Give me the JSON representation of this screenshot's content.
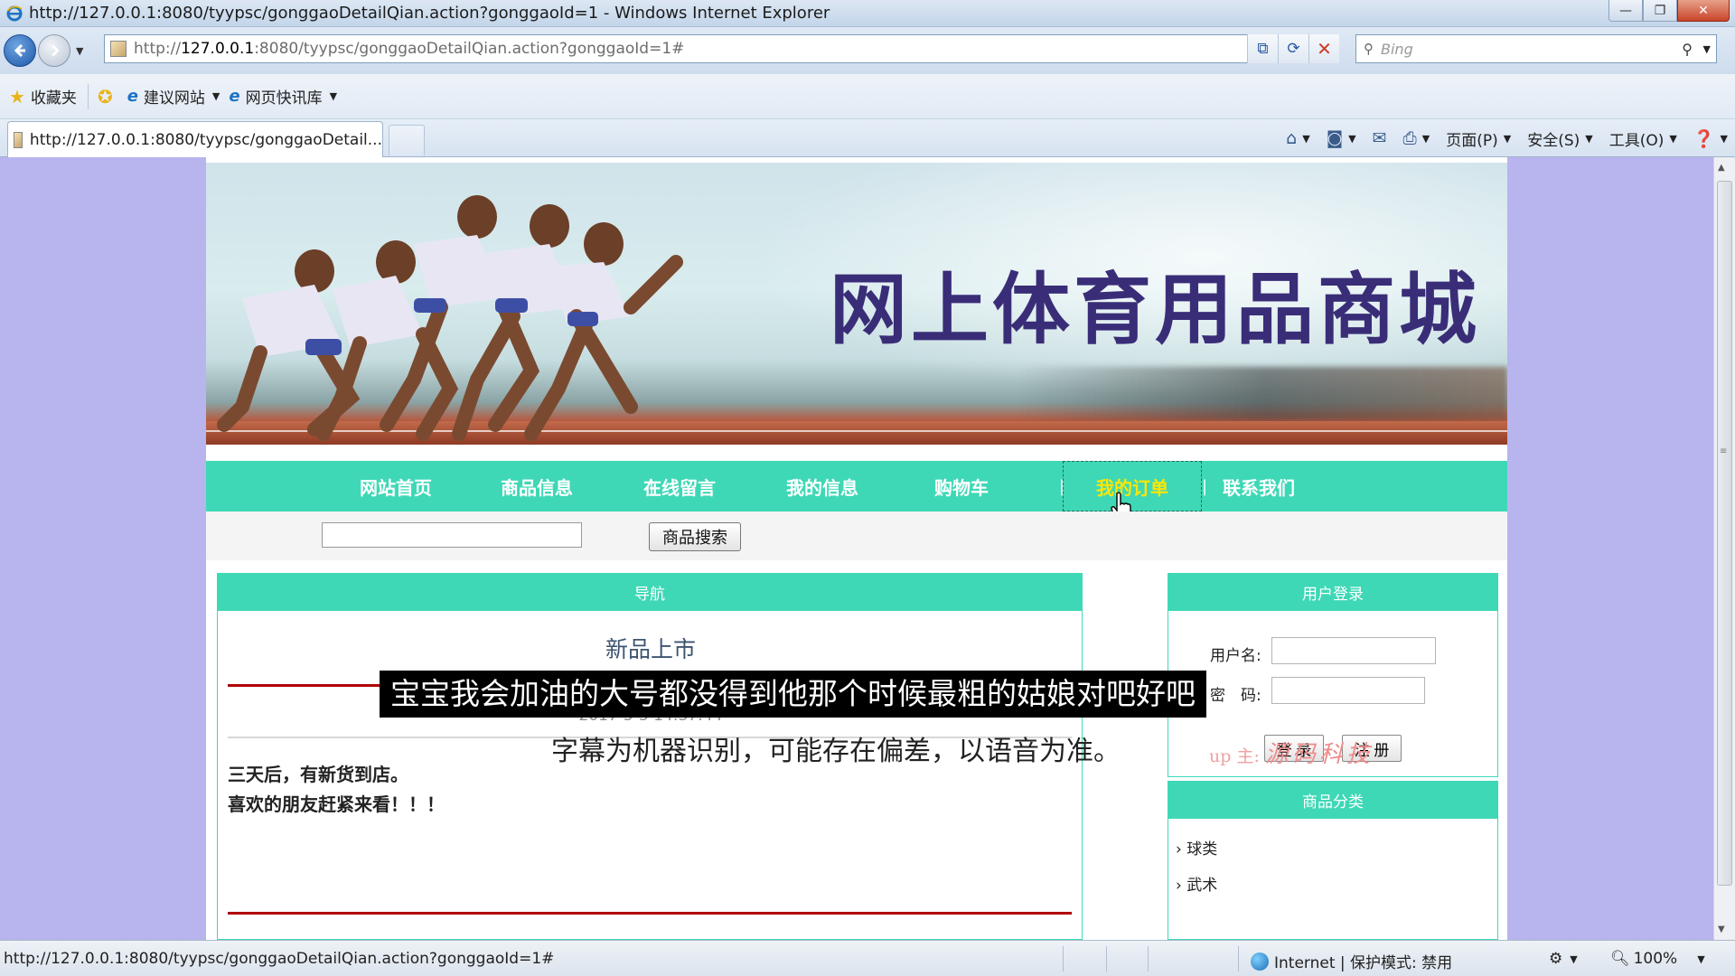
{
  "window": {
    "title": "http://127.0.0.1:8080/tyypsc/gonggaoDetailQian.action?gonggaoId=1 - Windows Internet Explorer",
    "controls": {
      "minimize": "—",
      "restore": "❐",
      "close": "✕"
    }
  },
  "address_bar": {
    "url_prefix": "http://",
    "url_host": "127.0.0.1",
    "url_rest": ":8080/tyypsc/gonggaoDetailQian.action?gonggaoId=1#",
    "search_placeholder": "Bing"
  },
  "favorites_bar": {
    "favorites_label": "收藏夹",
    "items": [
      "建议网站",
      "网页快讯库"
    ]
  },
  "tab": {
    "label": "http://127.0.0.1:8080/tyypsc/gonggaoDetail..."
  },
  "command_bar": {
    "page_menu": "页面(P)",
    "safety_menu": "安全(S)",
    "tools_menu": "工具(O)"
  },
  "site": {
    "banner_title": "网上体育用品商城",
    "nav": [
      "网站首页",
      "商品信息",
      "在线留言",
      "我的信息",
      "购物车",
      "我的订单",
      "联系我们"
    ],
    "nav_active_index": 5,
    "search_button": "商品搜索",
    "main_panel_title": "导航",
    "notice": {
      "title": "新品上市",
      "date": "2017-5-3 14:37:44",
      "body_lines": [
        "三天后，有新货到店。",
        "喜欢的朋友赶紧来看！！！"
      ]
    },
    "login": {
      "title": "用户登录",
      "username_label": "用户名:",
      "password_label": "密　码:",
      "login_button": "登 录",
      "register_button": "注 册"
    },
    "category": {
      "title": "商品分类",
      "items": [
        "球类",
        "武术"
      ]
    },
    "watermark": {
      "prefix": "up 主:",
      "name": "源码科技"
    }
  },
  "subtitles": {
    "line": "宝宝我会加油的大号都没得到他那个时候最粗的姑娘对吧好吧",
    "note": "字幕为机器识别，可能存在偏差，以语音为准。"
  },
  "status_bar": {
    "url": "http://127.0.0.1:8080/tyypsc/gonggaoDetailQian.action?gonggaoId=1#",
    "zone": "Internet | 保护模式: 禁用",
    "zoom": "100%"
  },
  "colors": {
    "nav_bg": "#3ed8b6",
    "page_bg": "#b8b4ee",
    "active_nav_text": "#ffe600",
    "banner_title": "#3a2d78",
    "divider_red": "#b00000"
  }
}
